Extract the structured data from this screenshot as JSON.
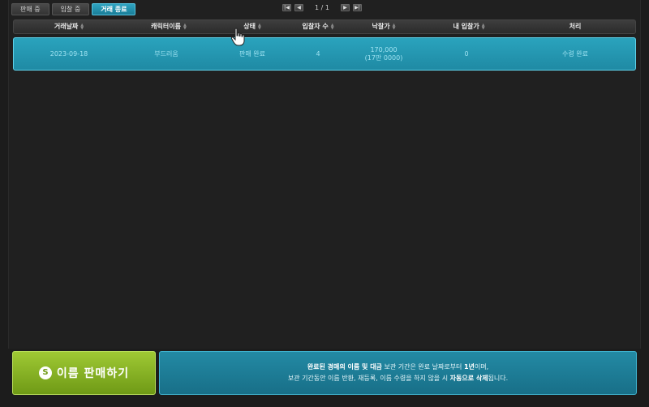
{
  "tabs": [
    {
      "label": "판매 중"
    },
    {
      "label": "입찰 중"
    },
    {
      "label": "거래 종료"
    }
  ],
  "pager": {
    "first": "|◀",
    "prev": "◀",
    "page_text": "1 / 1",
    "next": "▶",
    "last": "▶|"
  },
  "columns": [
    "거래날짜",
    "캐릭터이름",
    "상태",
    "입찰자 수",
    "낙찰가",
    "내 입찰가",
    "처리"
  ],
  "rows": [
    {
      "date": "2023-09-18",
      "character": "부드러움",
      "status": "판매 완료",
      "bidders": "4",
      "price": "170,000",
      "price_sub": "(17만 0000)",
      "my_bid": "0",
      "action": "수령 완료"
    }
  ],
  "sell_button": {
    "coin": "S",
    "label": "이름 판매하기"
  },
  "info": {
    "l1_a": "완료된 경매의 ",
    "l1_b": "이름 및 대금",
    "l1_c": " 보관 기간은 완료 날짜로부터 ",
    "l1_d": "1년",
    "l1_e": "이며,",
    "l2_a": "보관 기간동안 이름 반환, 재등록, 이름 수령을 하지 않을 시 ",
    "l2_b": "자동으로 삭제",
    "l2_c": "됩니다."
  },
  "colors": {
    "accent": "#2aa3bd",
    "sell": "#8cb826"
  }
}
